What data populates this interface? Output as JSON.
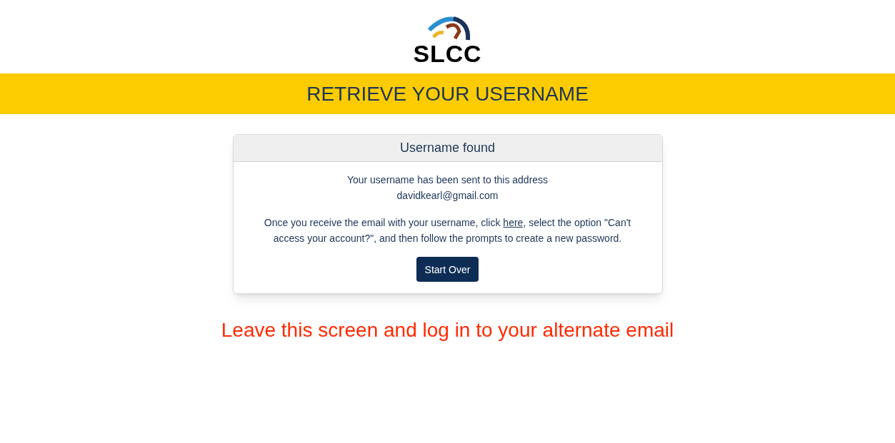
{
  "logo": {
    "text": "SLCC"
  },
  "banner": {
    "title": "RETRIEVE YOUR USERNAME"
  },
  "card": {
    "title": "Username found",
    "sent_message": "Your username has been sent to this address",
    "email": "davidkearl@gmail.com",
    "instructions": {
      "before": "Once you receive the email with your username, click ",
      "link": "here",
      "after": ", select the option \"Can't access your account?\", and then follow the prompts to create a new password."
    },
    "button": "Start Over"
  },
  "annotation": "Leave this screen and log in to your alternate email"
}
